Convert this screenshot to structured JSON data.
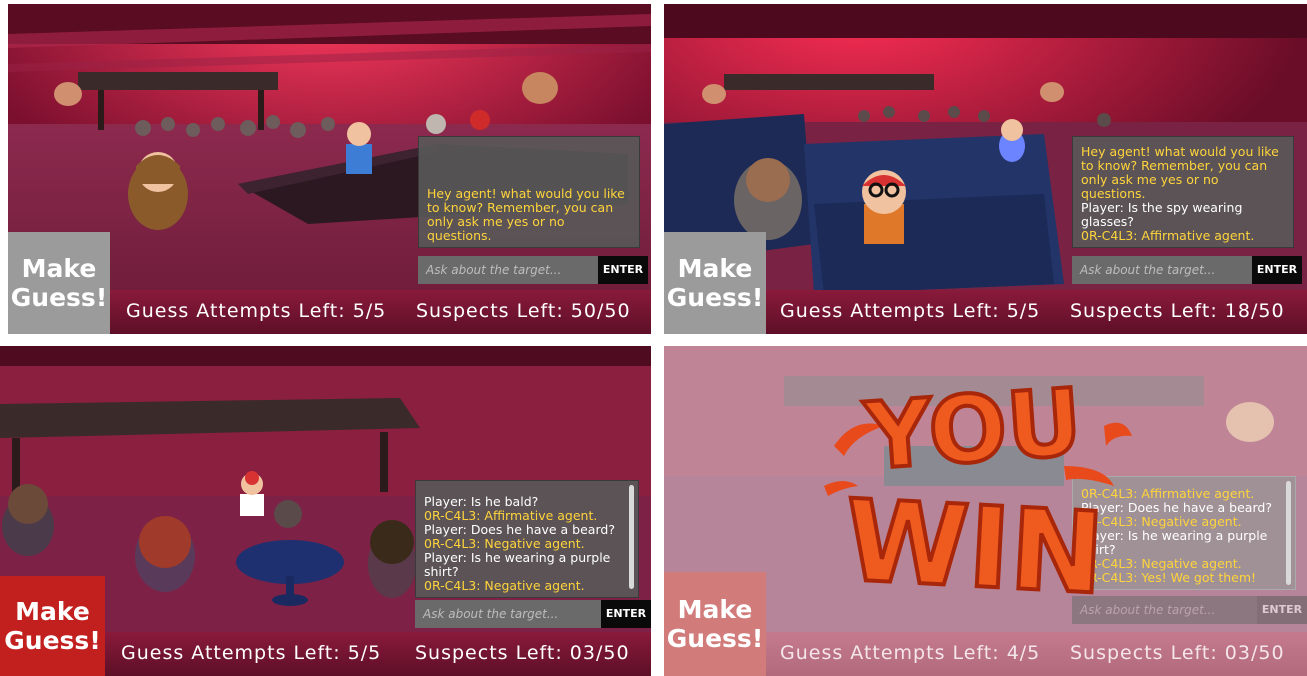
{
  "make_guess_label": [
    "Make",
    "Guess!"
  ],
  "input_placeholder": "Ask about the target...",
  "enter_label": "ENTER",
  "panels": [
    {
      "guess_attempts": "Guess Attempts Left: 5/5",
      "suspects": "Suspects Left: 50/50",
      "messages": [
        {
          "role": "agent",
          "text": "Hey agent! what would you like to know? Remember, you can only ask me yes or no questions."
        }
      ]
    },
    {
      "guess_attempts": "Guess Attempts Left: 5/5",
      "suspects": "Suspects Left: 18/50",
      "messages": [
        {
          "role": "agent",
          "text": "Hey agent! what would you like to know? Remember, you can only ask me yes or no questions."
        },
        {
          "role": "player",
          "text": "Player: Is the spy wearing glasses?"
        },
        {
          "role": "agent",
          "text": "0R-C4L3: Affirmative agent."
        }
      ]
    },
    {
      "guess_attempts": "Guess Attempts Left: 5/5",
      "suspects": "Suspects Left: 03/50",
      "messages": [
        {
          "role": "player",
          "text": "Player: Is he bald?"
        },
        {
          "role": "agent",
          "text": "0R-C4L3: Affirmative agent."
        },
        {
          "role": "player",
          "text": "Player: Does he have a beard?"
        },
        {
          "role": "agent",
          "text": "0R-C4L3: Negative agent."
        },
        {
          "role": "player",
          "text": "Player: Is he wearing a purple shirt?"
        },
        {
          "role": "agent",
          "text": "0R-C4L3: Negative agent."
        }
      ]
    },
    {
      "guess_attempts": "Guess Attempts Left: 4/5",
      "suspects": "Suspects Left: 03/50",
      "win_banner": [
        "YOU",
        "WIN"
      ],
      "messages": [
        {
          "role": "agent",
          "text": "0R-C4L3: Affirmative agent."
        },
        {
          "role": "player",
          "text": "Player: Does he have a beard?"
        },
        {
          "role": "agent",
          "text": "0R-C4L3: Negative agent."
        },
        {
          "role": "player",
          "text": "Player: Is he wearing a purple shirt?"
        },
        {
          "role": "agent",
          "text": "0R-C4L3: Negative agent."
        },
        {
          "role": "agent",
          "text": "0R-C4L3: Yes! We got them!"
        }
      ]
    }
  ],
  "colors": {
    "agent_text": "#ffd43b",
    "player_text": "#ffffff",
    "hud_bar": "#7a1533",
    "make_guess_idle": "#9b9b9b",
    "make_guess_active": "#c21f1f",
    "win_text": "#e84a1c"
  }
}
